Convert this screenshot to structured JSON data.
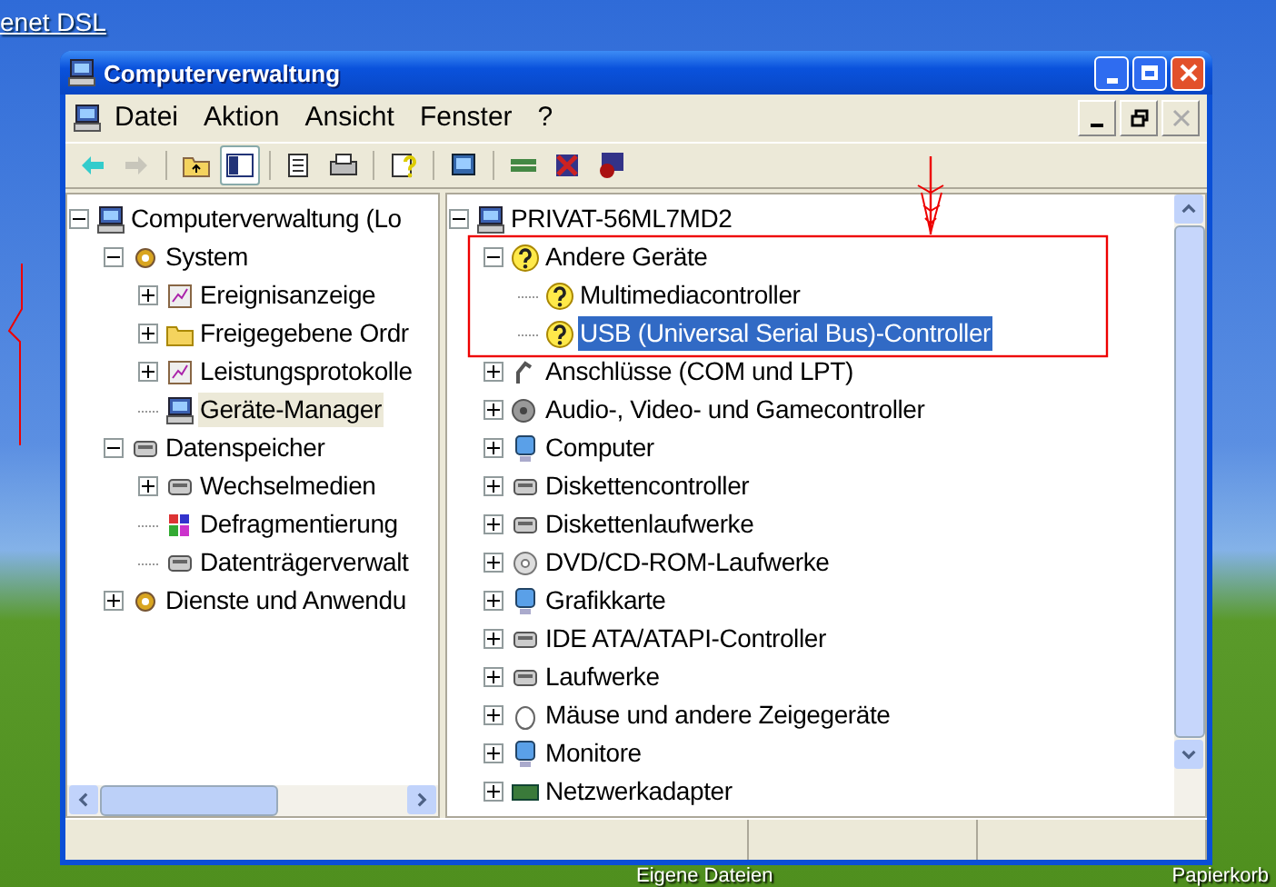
{
  "desktop": {
    "top_icons": [
      {
        "label": "enet DSL"
      }
    ],
    "bottom_icons": [
      {
        "label": "Eigene Dateien"
      },
      {
        "label": "Papierkorb"
      }
    ]
  },
  "window": {
    "title": "Computerverwaltung"
  },
  "menu": [
    "Datei",
    "Aktion",
    "Ansicht",
    "Fenster",
    "?"
  ],
  "toolbar": [
    {
      "kind": "back",
      "disabled": false,
      "pressed": false
    },
    {
      "kind": "forward",
      "disabled": true,
      "pressed": false
    },
    {
      "kind": "sep"
    },
    {
      "kind": "folder-up",
      "disabled": false,
      "pressed": false
    },
    {
      "kind": "tree",
      "disabled": false,
      "pressed": true
    },
    {
      "kind": "sep"
    },
    {
      "kind": "properties",
      "disabled": false,
      "pressed": false
    },
    {
      "kind": "print",
      "disabled": false,
      "pressed": false
    },
    {
      "kind": "sep"
    },
    {
      "kind": "help",
      "disabled": false,
      "pressed": false
    },
    {
      "kind": "sep"
    },
    {
      "kind": "scan",
      "disabled": false,
      "pressed": false
    },
    {
      "kind": "sep"
    },
    {
      "kind": "network",
      "disabled": false,
      "pressed": false
    },
    {
      "kind": "remove",
      "disabled": false,
      "pressed": false
    },
    {
      "kind": "disable",
      "disabled": false,
      "pressed": false
    }
  ],
  "left_tree": [
    {
      "label": "Computerverwaltung (Lo",
      "kind": "computer",
      "selected": false,
      "expanded": true,
      "children": [
        {
          "label": "System",
          "kind": "tools",
          "selected": false,
          "expanded": true,
          "children": [
            {
              "label": "Ereignisanzeige",
              "kind": "event",
              "selected": false,
              "expanded": false
            },
            {
              "label": "Freigegebene Ordr",
              "kind": "folder",
              "selected": false,
              "expanded": false
            },
            {
              "label": "Leistungsprotokolle",
              "kind": "chart",
              "selected": false,
              "expanded": false
            },
            {
              "label": "Geräte-Manager",
              "kind": "computer",
              "selected": true
            }
          ]
        },
        {
          "label": "Datenspeicher",
          "kind": "storage",
          "selected": false,
          "expanded": true,
          "children": [
            {
              "label": "Wechselmedien",
              "kind": "disk",
              "selected": false,
              "expanded": false
            },
            {
              "label": "Defragmentierung",
              "kind": "defrag",
              "selected": false
            },
            {
              "label": "Datenträgerverwalt",
              "kind": "storage",
              "selected": false
            }
          ]
        },
        {
          "label": "Dienste und Anwendu",
          "kind": "services",
          "selected": false,
          "expanded": false
        }
      ]
    }
  ],
  "right_tree": [
    {
      "label": "PRIVAT-56ML7MD2",
      "kind": "computer",
      "selected": false,
      "expanded": true,
      "children": [
        {
          "label": "Andere Geräte",
          "kind": "question",
          "selected": false,
          "expanded": true,
          "children": [
            {
              "label": "Multimediacontroller",
              "kind": "warning",
              "selected": false
            },
            {
              "label": "USB (Universal Serial Bus)-Controller",
              "kind": "warning",
              "selected": true
            }
          ]
        },
        {
          "label": "Anschlüsse (COM und LPT)",
          "kind": "port",
          "selected": false,
          "expanded": false
        },
        {
          "label": "Audio-, Video- und Gamecontroller",
          "kind": "speaker",
          "selected": false,
          "expanded": false
        },
        {
          "label": "Computer",
          "kind": "monitor",
          "selected": false,
          "expanded": false
        },
        {
          "label": "Diskettencontroller",
          "kind": "drive",
          "selected": false,
          "expanded": false
        },
        {
          "label": "Diskettenlaufwerke",
          "kind": "disk",
          "selected": false,
          "expanded": false
        },
        {
          "label": "DVD/CD-ROM-Laufwerke",
          "kind": "cd",
          "selected": false,
          "expanded": false
        },
        {
          "label": "Grafikkarte",
          "kind": "monitor",
          "selected": false,
          "expanded": false
        },
        {
          "label": "IDE ATA/ATAPI-Controller",
          "kind": "drive",
          "selected": false,
          "expanded": false
        },
        {
          "label": "Laufwerke",
          "kind": "disk",
          "selected": false,
          "expanded": false
        },
        {
          "label": "Mäuse und andere Zeigegeräte",
          "kind": "mouse",
          "selected": false,
          "expanded": false
        },
        {
          "label": "Monitore",
          "kind": "monitor",
          "selected": false,
          "expanded": false
        },
        {
          "label": "Netzwerkadapter",
          "kind": "network",
          "selected": false,
          "expanded": false
        }
      ]
    }
  ]
}
